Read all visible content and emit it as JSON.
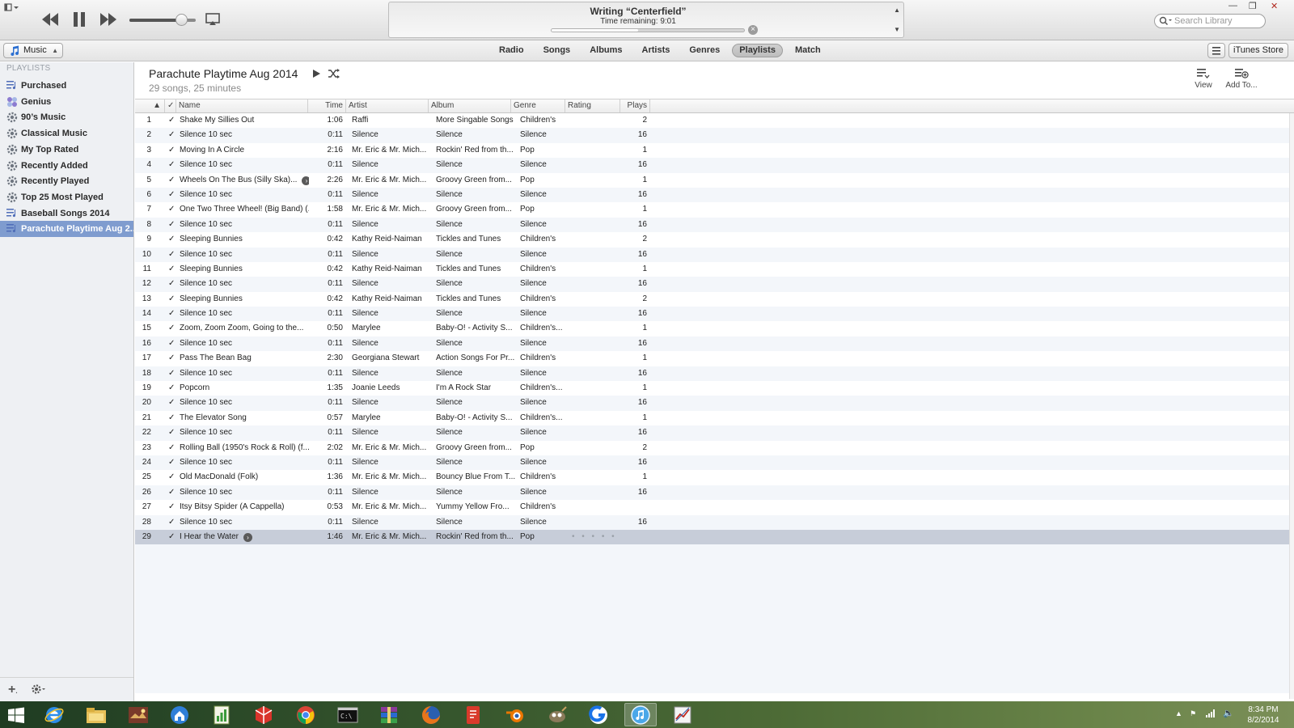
{
  "player": {
    "lcd_title": "Writing “Centerfield”",
    "lcd_subtitle": "Time remaining: 9:01",
    "lcd_progress": 0.45,
    "volume": 0.78,
    "search_placeholder": "Search Library"
  },
  "nav": {
    "source": "Music",
    "tabs": [
      "Radio",
      "Songs",
      "Albums",
      "Artists",
      "Genres",
      "Playlists",
      "Match"
    ],
    "active_tab": "Playlists",
    "store": "iTunes Store"
  },
  "sidebar": {
    "heading": "PLAYLISTS",
    "items": [
      {
        "label": "Purchased",
        "icon": "playlist-icon"
      },
      {
        "label": "Genius",
        "icon": "genius-icon"
      },
      {
        "label": "90’s Music",
        "icon": "smart-playlist-gear-icon"
      },
      {
        "label": "Classical Music",
        "icon": "smart-playlist-gear-icon"
      },
      {
        "label": "My Top Rated",
        "icon": "smart-playlist-gear-icon"
      },
      {
        "label": "Recently Added",
        "icon": "smart-playlist-gear-icon"
      },
      {
        "label": "Recently Played",
        "icon": "smart-playlist-gear-icon"
      },
      {
        "label": "Top 25 Most Played",
        "icon": "smart-playlist-gear-icon"
      },
      {
        "label": "Baseball Songs 2014",
        "icon": "playlist-icon"
      },
      {
        "label": "Parachute Playtime Aug 2...",
        "icon": "playlist-icon"
      }
    ],
    "selected_index": 9
  },
  "playlist": {
    "title": "Parachute Playtime Aug 2014",
    "subtitle": "29 songs, 25 minutes",
    "view_label": "View",
    "add_label": "Add To..."
  },
  "table": {
    "columns": {
      "check": "✓",
      "name": "Name",
      "time": "Time",
      "artist": "Artist",
      "album": "Album",
      "genre": "Genre",
      "rating": "Rating",
      "plays": "Plays"
    },
    "selected_row": 29,
    "rows": [
      {
        "n": "1",
        "name": "Shake My Sillies Out",
        "time": "1:06",
        "artist": "Raffi",
        "album": "More Singable Songs",
        "genre": "Children's",
        "plays": "2"
      },
      {
        "n": "2",
        "name": "Silence 10 sec",
        "time": "0:11",
        "artist": "Silence",
        "album": "Silence",
        "genre": "Silence",
        "plays": "16"
      },
      {
        "n": "3",
        "name": "Moving In A Circle",
        "time": "2:16",
        "artist": "Mr. Eric & Mr. Mich...",
        "album": "Rockin' Red from th...",
        "genre": "Pop",
        "plays": "1"
      },
      {
        "n": "4",
        "name": "Silence 10 sec",
        "time": "0:11",
        "artist": "Silence",
        "album": "Silence",
        "genre": "Silence",
        "plays": "16"
      },
      {
        "n": "5",
        "name": "Wheels On The Bus (Silly Ska)...",
        "time": "2:26",
        "artist": "Mr. Eric & Mr. Mich...",
        "album": "Groovy Green from...",
        "genre": "Pop",
        "plays": "1",
        "go": true
      },
      {
        "n": "6",
        "name": "Silence 10 sec",
        "time": "0:11",
        "artist": "Silence",
        "album": "Silence",
        "genre": "Silence",
        "plays": "16"
      },
      {
        "n": "7",
        "name": "One Two Three Wheel! (Big Band) (...",
        "time": "1:58",
        "artist": "Mr. Eric & Mr. Mich...",
        "album": "Groovy Green from...",
        "genre": "Pop",
        "plays": "1"
      },
      {
        "n": "8",
        "name": "Silence 10 sec",
        "time": "0:11",
        "artist": "Silence",
        "album": "Silence",
        "genre": "Silence",
        "plays": "16"
      },
      {
        "n": "9",
        "name": "Sleeping Bunnies",
        "time": "0:42",
        "artist": "Kathy Reid-Naiman",
        "album": "Tickles and Tunes",
        "genre": "Children's",
        "plays": "2"
      },
      {
        "n": "10",
        "name": "Silence 10 sec",
        "time": "0:11",
        "artist": "Silence",
        "album": "Silence",
        "genre": "Silence",
        "plays": "16"
      },
      {
        "n": "11",
        "name": "Sleeping Bunnies",
        "time": "0:42",
        "artist": "Kathy Reid-Naiman",
        "album": "Tickles and Tunes",
        "genre": "Children's",
        "plays": "1"
      },
      {
        "n": "12",
        "name": "Silence 10 sec",
        "time": "0:11",
        "artist": "Silence",
        "album": "Silence",
        "genre": "Silence",
        "plays": "16"
      },
      {
        "n": "13",
        "name": "Sleeping Bunnies",
        "time": "0:42",
        "artist": "Kathy Reid-Naiman",
        "album": "Tickles and Tunes",
        "genre": "Children's",
        "plays": "2"
      },
      {
        "n": "14",
        "name": "Silence 10 sec",
        "time": "0:11",
        "artist": "Silence",
        "album": "Silence",
        "genre": "Silence",
        "plays": "16"
      },
      {
        "n": "15",
        "name": "Zoom, Zoom Zoom, Going to the...",
        "time": "0:50",
        "artist": "Marylee",
        "album": "Baby-O! - Activity S...",
        "genre": "Children's...",
        "plays": "1"
      },
      {
        "n": "16",
        "name": "Silence 10 sec",
        "time": "0:11",
        "artist": "Silence",
        "album": "Silence",
        "genre": "Silence",
        "plays": "16"
      },
      {
        "n": "17",
        "name": "Pass The Bean Bag",
        "time": "2:30",
        "artist": "Georgiana Stewart",
        "album": "Action Songs For Pr...",
        "genre": "Children's",
        "plays": "1"
      },
      {
        "n": "18",
        "name": "Silence 10 sec",
        "time": "0:11",
        "artist": "Silence",
        "album": "Silence",
        "genre": "Silence",
        "plays": "16"
      },
      {
        "n": "19",
        "name": "Popcorn",
        "time": "1:35",
        "artist": "Joanie Leeds",
        "album": "I'm A Rock Star",
        "genre": "Children's...",
        "plays": "1"
      },
      {
        "n": "20",
        "name": "Silence 10 sec",
        "time": "0:11",
        "artist": "Silence",
        "album": "Silence",
        "genre": "Silence",
        "plays": "16"
      },
      {
        "n": "21",
        "name": "The Elevator Song",
        "time": "0:57",
        "artist": "Marylee",
        "album": "Baby-O! - Activity S...",
        "genre": "Children's...",
        "plays": "1"
      },
      {
        "n": "22",
        "name": "Silence 10 sec",
        "time": "0:11",
        "artist": "Silence",
        "album": "Silence",
        "genre": "Silence",
        "plays": "16"
      },
      {
        "n": "23",
        "name": "Rolling Ball (1950's Rock & Roll) (f...",
        "time": "2:02",
        "artist": "Mr. Eric & Mr. Mich...",
        "album": "Groovy Green from...",
        "genre": "Pop",
        "plays": "2"
      },
      {
        "n": "24",
        "name": "Silence 10 sec",
        "time": "0:11",
        "artist": "Silence",
        "album": "Silence",
        "genre": "Silence",
        "plays": "16"
      },
      {
        "n": "25",
        "name": "Old MacDonald (Folk)",
        "time": "1:36",
        "artist": "Mr. Eric & Mr. Mich...",
        "album": "Bouncy Blue From T...",
        "genre": "Children's",
        "plays": "1"
      },
      {
        "n": "26",
        "name": "Silence 10 sec",
        "time": "0:11",
        "artist": "Silence",
        "album": "Silence",
        "genre": "Silence",
        "plays": "16"
      },
      {
        "n": "27",
        "name": "Itsy Bitsy Spider (A Cappella)",
        "time": "0:53",
        "artist": "Mr. Eric & Mr. Mich...",
        "album": "Yummy Yellow Fro...",
        "genre": "Children's",
        "plays": ""
      },
      {
        "n": "28",
        "name": "Silence 10 sec",
        "time": "0:11",
        "artist": "Silence",
        "album": "Silence",
        "genre": "Silence",
        "plays": "16"
      },
      {
        "n": "29",
        "name": "I Hear the Water",
        "time": "1:46",
        "artist": "Mr. Eric & Mr. Mich...",
        "album": "Rockin' Red from th...",
        "genre": "Pop",
        "plays": "",
        "go": true,
        "rating": "• • • • •"
      }
    ]
  },
  "taskbar": {
    "apps": [
      "internet-explorer-icon",
      "file-explorer-icon",
      "game-app-icon",
      "home-app-icon",
      "spreadsheet-app-icon",
      "sketchup-icon",
      "chrome-icon",
      "command-prompt-icon",
      "winrar-icon",
      "firefox-icon",
      "red-app-icon",
      "blender-icon",
      "gimp-icon",
      "blue-app-icon",
      "itunes-icon",
      "chart-app-icon"
    ],
    "active_app": "itunes-icon",
    "time": "8:34 PM",
    "date": "8/2/2014"
  },
  "colors": {
    "selection": "#7f9ccf",
    "row_selected": "#c7cdd9",
    "row_alt": "#f3f6fa"
  }
}
